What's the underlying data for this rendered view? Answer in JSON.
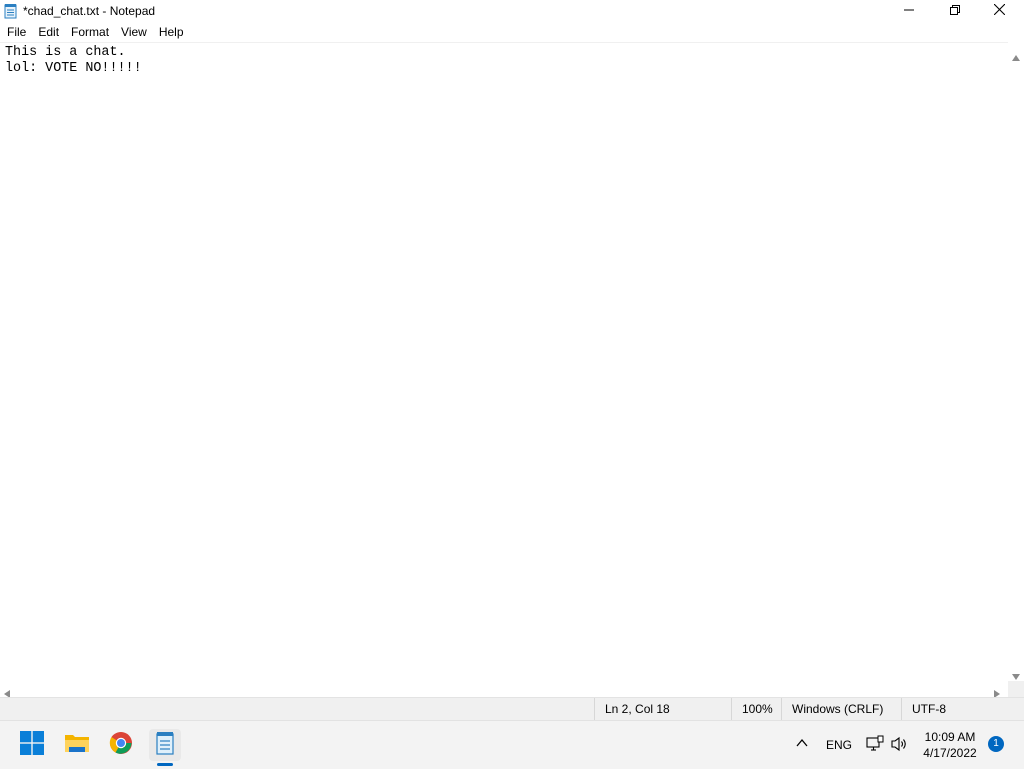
{
  "window": {
    "title": "*chad_chat.txt - Notepad",
    "controls": {
      "minimize": "minimize",
      "maximize": "maximize",
      "close": "close"
    }
  },
  "menu": {
    "items": [
      {
        "label": "File"
      },
      {
        "label": "Edit"
      },
      {
        "label": "Format"
      },
      {
        "label": "View"
      },
      {
        "label": "Help"
      }
    ]
  },
  "editor": {
    "lines": [
      "This is a chat.",
      "lol: VOTE NO!!!!!"
    ]
  },
  "status": {
    "position": "Ln 2, Col 18",
    "zoom": "100%",
    "line_ending": "Windows (CRLF)",
    "encoding": "UTF-8"
  },
  "taskbar": {
    "pinned": [
      "windows-start-icon",
      "file-explorer-icon",
      "chrome-icon",
      "notepad-icon"
    ],
    "active": "notepad",
    "language": "ENG",
    "time": "10:09 AM",
    "date": "4/17/2022",
    "notification_count": "1",
    "accent_color": "#0067c0"
  }
}
